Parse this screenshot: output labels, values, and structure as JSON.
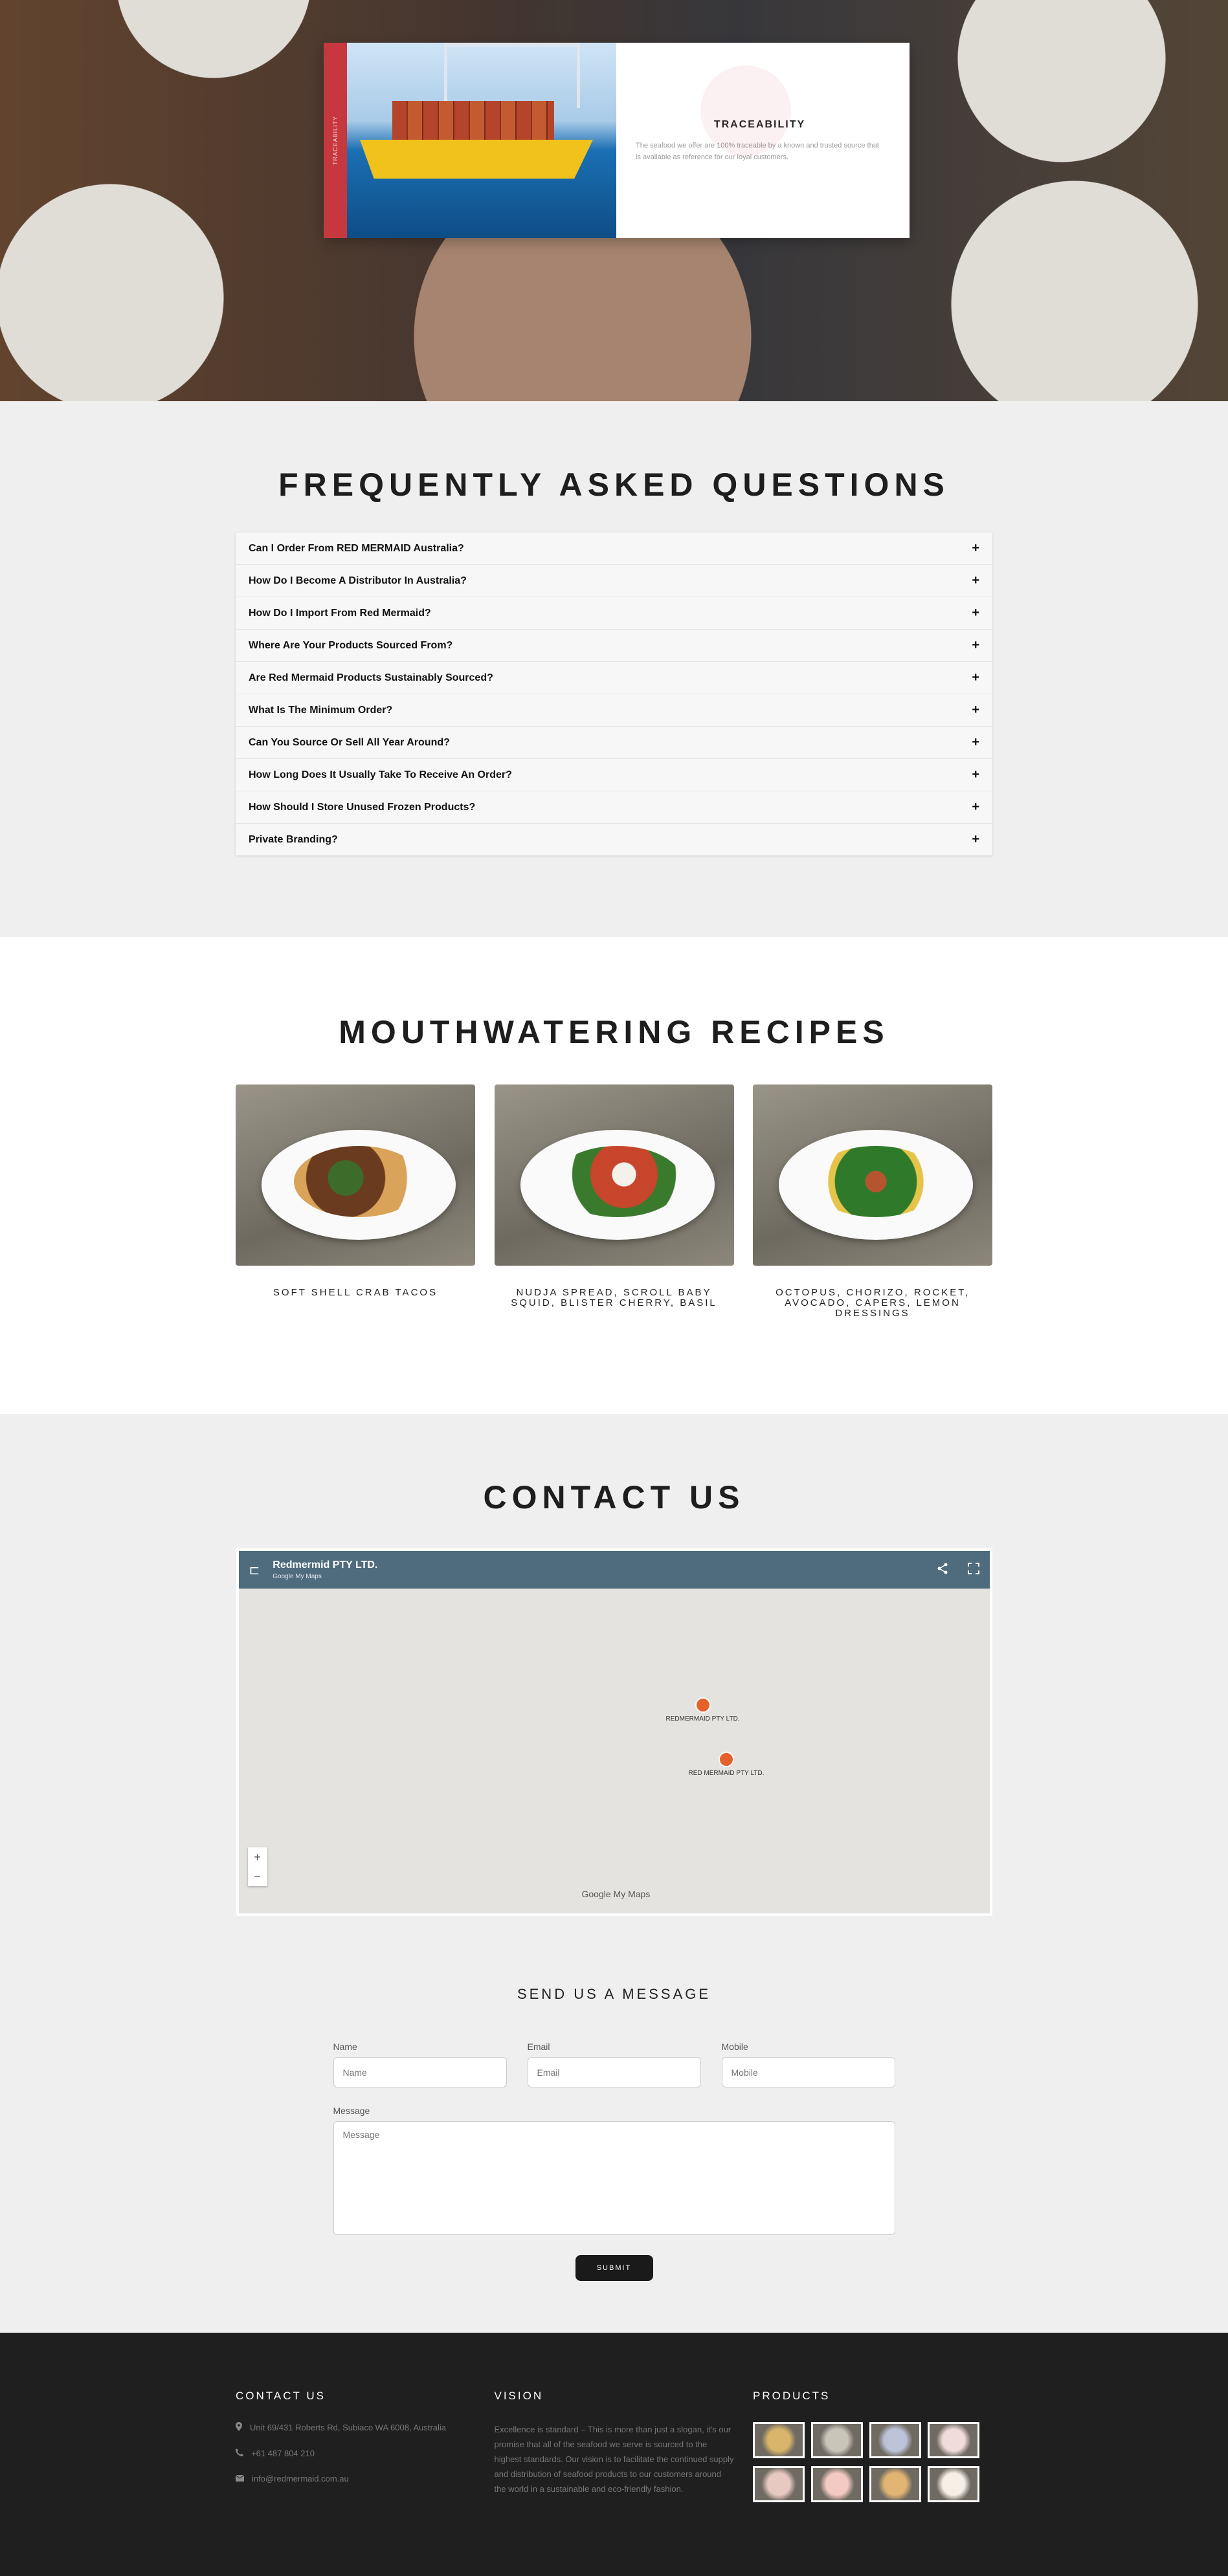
{
  "hero": {
    "card_strip_text": "TRACEABILITY",
    "card_title": "TRACEABILITY",
    "card_desc": "The seafood we offer are 100% traceable by a known and trusted source that is available as reference for our loyal customers."
  },
  "faq": {
    "title": "FREQUENTLY ASKED QUESTIONS",
    "items": [
      "Can I Order From RED MERMAID Australia?",
      "How Do I Become A Distributor In Australia?",
      "How Do I Import From Red Mermaid?",
      "Where Are Your Products Sourced From?",
      "Are Red Mermaid Products Sustainably Sourced?",
      "What Is The Minimum Order?",
      "Can You Source Or Sell All Year Around?",
      "How Long Does It Usually Take To Receive An Order?",
      "How Should I Store Unused Frozen Products?",
      "Private Branding?"
    ],
    "toggle_symbol": "+"
  },
  "recipes": {
    "title": "MOUTHWATERING RECIPES",
    "items": [
      "SOFT SHELL CRAB TACOS",
      "NUDJA SPREAD, SCROLL BABY SQUID, BLISTER CHERRY, BASIL",
      "OCTOPUS, CHORIZO, ROCKET, AVOCADO, CAPERS, LEMON DRESSINGS"
    ]
  },
  "contact": {
    "title": "CONTACT US",
    "map": {
      "name": "Redmermid PTY LTD.",
      "subtitle": "Google My Maps",
      "pin1": "REDMERMAID PTY LTD.",
      "pin2": "RED MERMAID PTY LTD.",
      "zoom_in": "+",
      "zoom_out": "−",
      "logo": "Google My Maps",
      "menu_icon": "⊏",
      "share_icon": "share-icon",
      "fullscreen_icon": "fullscreen-icon"
    },
    "message_title": "SEND US A MESSAGE",
    "form": {
      "name_label": "Name",
      "name_placeholder": "Name",
      "email_label": "Email",
      "email_placeholder": "Email",
      "mobile_label": "Mobile",
      "mobile_placeholder": "Mobile",
      "message_label": "Message",
      "message_placeholder": "Message",
      "submit_label": "SUBMIT"
    }
  },
  "footer": {
    "contact_title": "CONTACT US",
    "address": "Unit 69/431 Roberts Rd, Subiaco WA 6008, Australia",
    "phone": "+61 487 804 210",
    "email": "info@redmermaid.com.au",
    "vision_title": "VISION",
    "vision_text": "Excellence is standard – This is more than just a slogan, it's our promise that all of the seafood we serve is sourced to the highest standards. Our vision is to facilitate the continued supply and distribution of seafood products to our customers around the world in a sustainable and eco-friendly fashion.",
    "products_title": "PRODUCTS",
    "product_colors": [
      "#d8b56a",
      "#c9c5b8",
      "#bcc3d6",
      "#f0dcd8",
      "#e8c9c2",
      "#f3c9c3",
      "#e0b574",
      "#f5efe6"
    ]
  }
}
